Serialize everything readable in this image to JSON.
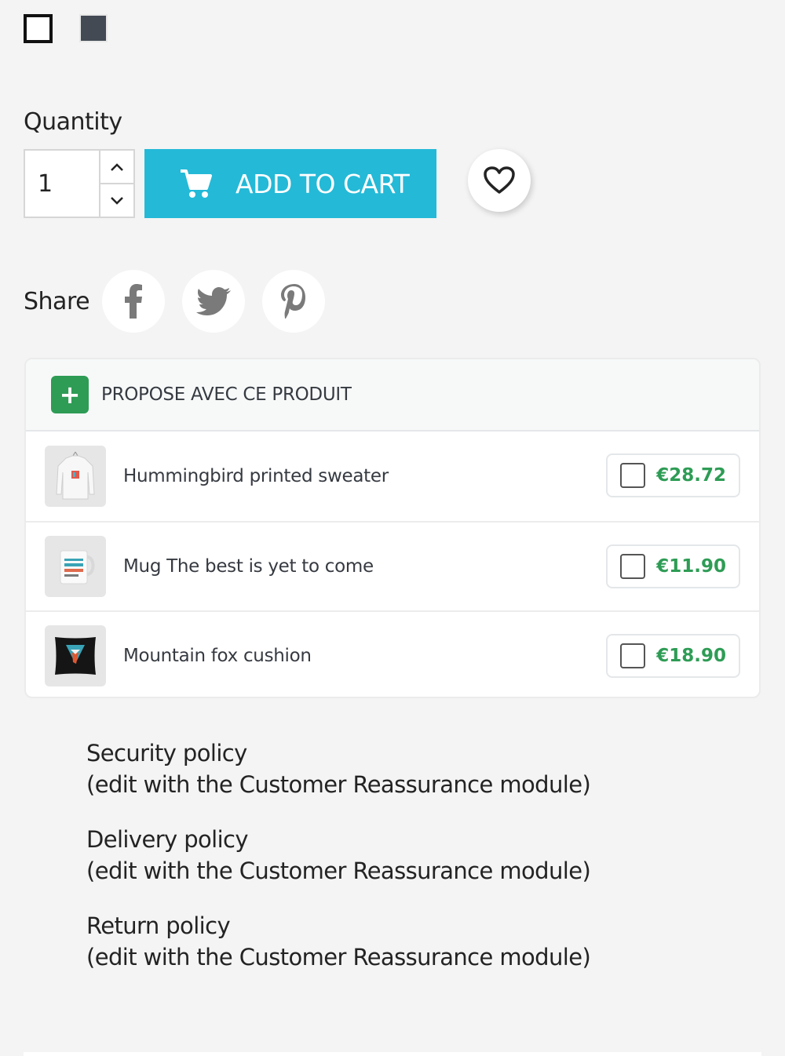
{
  "variants": {
    "colors": [
      {
        "name": "White",
        "hex": "#ffffff"
      },
      {
        "name": "Gray",
        "hex": "#434a54"
      }
    ]
  },
  "quantity": {
    "label": "Quantity",
    "value": "1"
  },
  "add_to_cart": {
    "label": "ADD TO CART",
    "color": "#24b9d7"
  },
  "wishlist": {
    "icon": "heart-outline-icon"
  },
  "share": {
    "label": "Share",
    "networks": [
      "facebook",
      "twitter",
      "pinterest"
    ]
  },
  "cross_sell": {
    "title": "PROPOSE AVEC CE PRODUIT",
    "accent": "#2e9c55",
    "products": [
      {
        "name": "Hummingbird printed sweater",
        "price": "€28.72",
        "checked": false
      },
      {
        "name": "Mug The best is yet to come",
        "price": "€11.90",
        "checked": false
      },
      {
        "name": "Mountain fox cushion",
        "price": "€18.90",
        "checked": false
      }
    ]
  },
  "reassurance": [
    {
      "title": "Security policy",
      "subtitle": "(edit with the Customer Reassurance module)"
    },
    {
      "title": "Delivery policy",
      "subtitle": "(edit with the Customer Reassurance module)"
    },
    {
      "title": "Return policy",
      "subtitle": "(edit with the Customer Reassurance module)"
    }
  ]
}
